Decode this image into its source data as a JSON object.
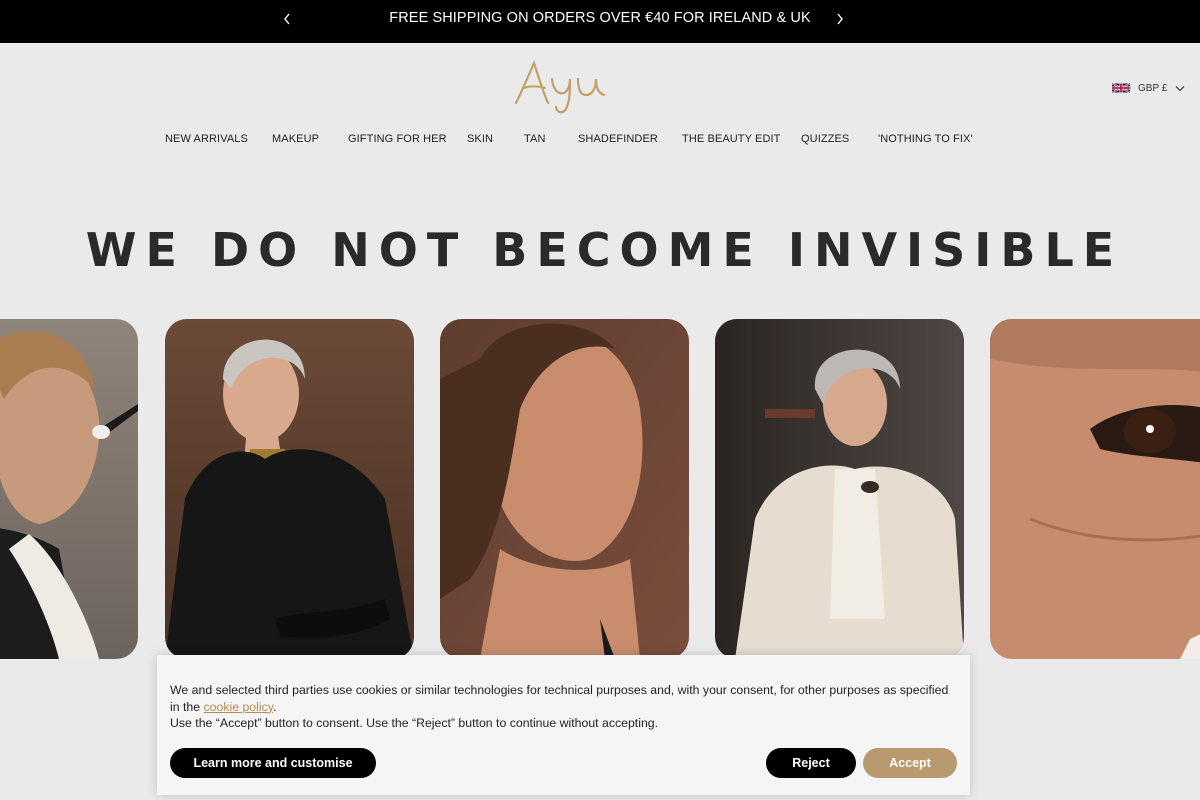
{
  "announcement": {
    "text": "FREE SHIPPING ON ORDERS OVER €40 FOR IRELAND & UK"
  },
  "header": {
    "logo_text": "Ayu",
    "currency": "GBP £",
    "flag": "uk-flag-icon"
  },
  "nav": {
    "items": [
      "NEW ARRIVALS",
      "MAKEUP",
      "GIFTING FOR HER",
      "SKIN",
      "TAN",
      "SHADEFINDER",
      "THE BEAUTY EDIT",
      "QUIZZES",
      "'NOTHING TO FIX'"
    ]
  },
  "hero": {
    "title": "WE DO NOT BECOME INVISIBLE"
  },
  "carousel": {
    "cards": [
      "photo-woman-makeup-brush",
      "photo-silver-hair-black-coat",
      "photo-woman-profile-brown",
      "photo-woman-beige-coat-lipstick",
      "photo-eye-closeup"
    ]
  },
  "cookie": {
    "line1_before": "We and selected third parties use cookies or similar technologies for technical purposes and, with your consent, for other purposes as specified in the ",
    "link": "cookie policy",
    "line1_after": ".",
    "line2": "Use the “Accept” button to consent. Use the “Reject” button to continue without accepting.",
    "learn_label": "Learn more and customise",
    "reject_label": "Reject",
    "accept_label": "Accept"
  },
  "colors": {
    "accent_gold": "#b99a6e",
    "link_gold": "#b58a55",
    "background": "#eaeaea",
    "banner": "#000000"
  }
}
